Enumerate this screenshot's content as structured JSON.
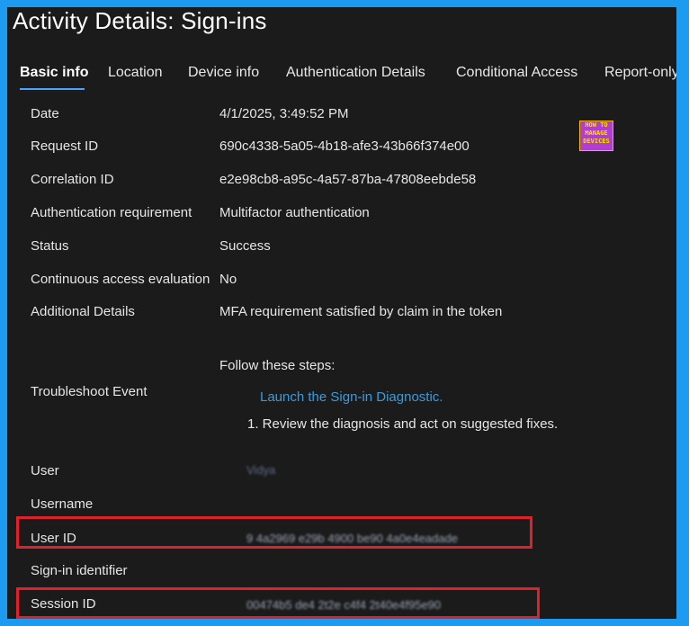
{
  "title": "Activity Details: Sign-ins",
  "tabs": [
    {
      "label": "Basic info"
    },
    {
      "label": "Location"
    },
    {
      "label": "Device info"
    },
    {
      "label": "Authentication Details"
    },
    {
      "label": "Conditional Access"
    },
    {
      "label": "Report-only"
    }
  ],
  "logo": {
    "line1": "HOW TO",
    "line2": "MANAGE",
    "line3": "DEVICES"
  },
  "rows": {
    "date": {
      "label": "Date",
      "value": "4/1/2025, 3:49:52 PM"
    },
    "request_id": {
      "label": "Request ID",
      "value": "690c4338-5a05-4b18-afe3-43b66f374e00"
    },
    "correlation_id": {
      "label": "Correlation ID",
      "value": "e2e98cb8-a95c-4a57-87ba-47808eebde58"
    },
    "auth_requirement": {
      "label": "Authentication requirement",
      "value": "Multifactor authentication"
    },
    "status": {
      "label": "Status",
      "value": "Success"
    },
    "cae": {
      "label": "Continuous access evaluation",
      "value": "No"
    },
    "additional": {
      "label": "Additional Details",
      "value": "MFA requirement satisfied by claim in the token"
    },
    "troubleshoot": {
      "label": "Troubleshoot Event",
      "intro": "Follow these steps:",
      "link": "Launch the Sign-in Diagnostic.",
      "step": "1. Review the diagnosis and act on suggested fixes."
    },
    "user": {
      "label": "User",
      "value": "Vidya"
    },
    "username": {
      "label": "Username",
      "value": ""
    },
    "user_id": {
      "label": "User ID",
      "value": "9 4a2969 e29b 4900 be90 4a0e4eadade"
    },
    "signin_identifier": {
      "label": "Sign-in identifier",
      "value": ""
    },
    "session_id": {
      "label": "Session ID",
      "value": "00474b5 de4 2t2e c4f4 2t40e4f95e90"
    }
  },
  "colors": {
    "background": "#1b1b1b",
    "accent": "#4aa3ff",
    "link": "#3a9bdc",
    "highlight": "#e0202a",
    "border": "#1d9bf0"
  }
}
